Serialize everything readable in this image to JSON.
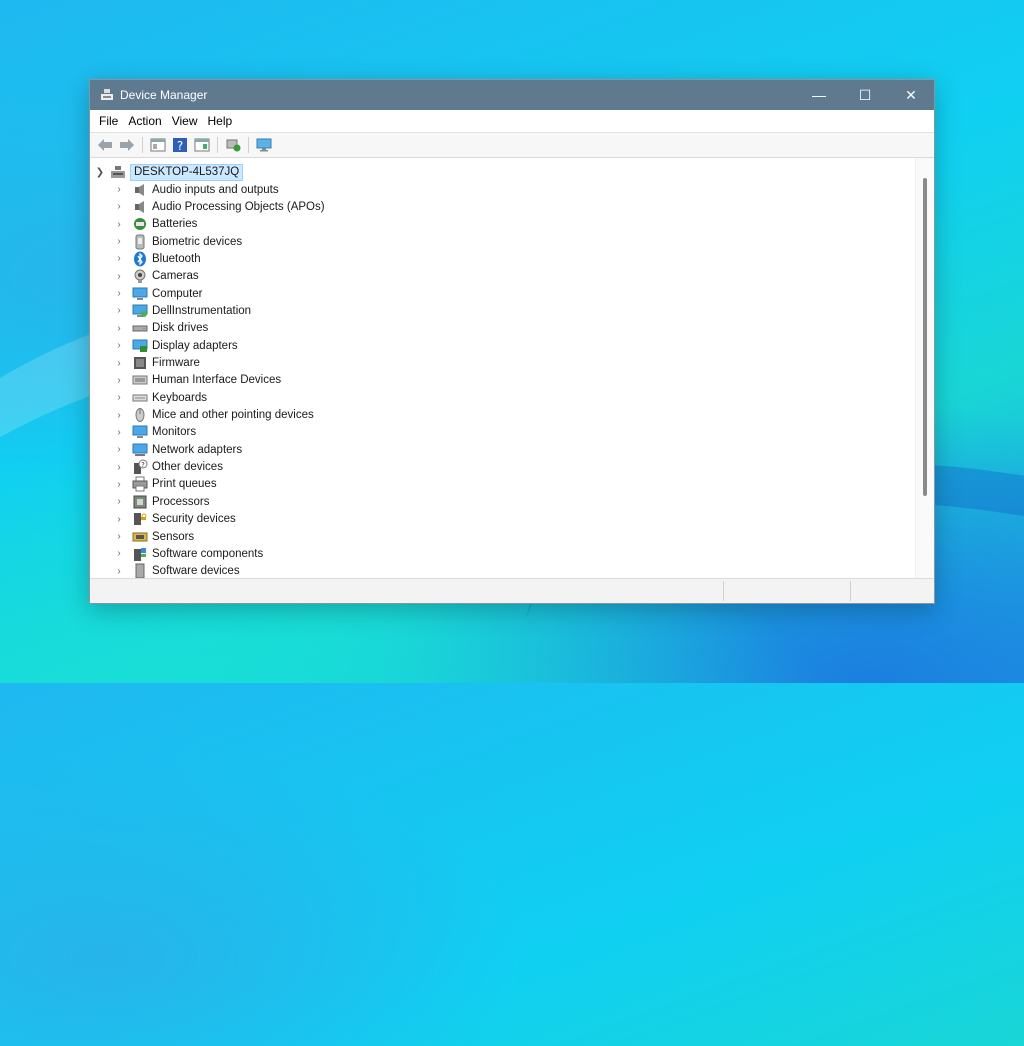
{
  "window": {
    "title": "Device Manager",
    "controls": {
      "minimize": "—",
      "maximize": "☐",
      "close": "✕"
    }
  },
  "menu": [
    "File",
    "Action",
    "View",
    "Help"
  ],
  "toolbar_icons": [
    "back-icon",
    "forward-icon",
    "properties-icon",
    "help-icon",
    "details-view-icon",
    "scan-hardware-icon",
    "monitor-icon"
  ],
  "tree": {
    "root": "DESKTOP-4L537JQ",
    "items": [
      {
        "label": "Audio inputs and outputs",
        "icon": "speaker-icon"
      },
      {
        "label": "Audio Processing Objects (APOs)",
        "icon": "speaker-icon"
      },
      {
        "label": "Batteries",
        "icon": "battery-icon"
      },
      {
        "label": "Biometric devices",
        "icon": "biometric-icon"
      },
      {
        "label": "Bluetooth",
        "icon": "bluetooth-icon"
      },
      {
        "label": "Cameras",
        "icon": "camera-icon"
      },
      {
        "label": "Computer",
        "icon": "computer-icon"
      },
      {
        "label": "DellInstrumentation",
        "icon": "network-monitor-icon"
      },
      {
        "label": "Disk drives",
        "icon": "disk-icon"
      },
      {
        "label": "Display adapters",
        "icon": "display-adapter-icon"
      },
      {
        "label": "Firmware",
        "icon": "firmware-icon"
      },
      {
        "label": "Human Interface Devices",
        "icon": "hid-icon"
      },
      {
        "label": "Keyboards",
        "icon": "keyboard-icon"
      },
      {
        "label": "Mice and other pointing devices",
        "icon": "mouse-icon"
      },
      {
        "label": "Monitors",
        "icon": "monitor-icon"
      },
      {
        "label": "Network adapters",
        "icon": "network-adapter-icon"
      },
      {
        "label": "Other devices",
        "icon": "other-device-icon"
      },
      {
        "label": "Print queues",
        "icon": "printer-icon"
      },
      {
        "label": "Processors",
        "icon": "processor-icon"
      },
      {
        "label": "Security devices",
        "icon": "security-icon"
      },
      {
        "label": "Sensors",
        "icon": "sensor-icon"
      },
      {
        "label": "Software components",
        "icon": "software-component-icon"
      },
      {
        "label": "Software devices",
        "icon": "software-device-icon"
      }
    ]
  },
  "colors": {
    "titlebar": "#5f7a8f",
    "selection": "#cce8ff"
  }
}
